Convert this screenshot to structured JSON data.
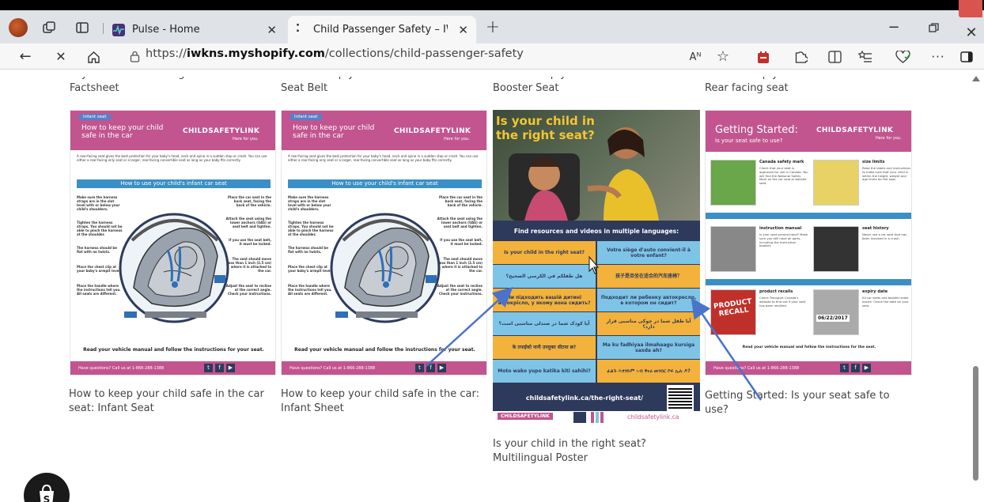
{
  "browser": {
    "tabs": [
      {
        "title": "Pulse - Home",
        "active": false
      },
      {
        "title": "Child Passenger Safety – IWK Chil",
        "active": true
      }
    ],
    "new_tab_label": "+",
    "url_prefix": "https://",
    "url_domain": "iwkns.myshopify.com",
    "url_path": "/collections/child-passenger-safety",
    "reader_label": "Aᴺ"
  },
  "top_captions": [
    "Is your child in the Right Seat? - Factsheet",
    "How to keep your child safe in the car: Seat Belt",
    "How to keep your child safe in the car: Booster Seat",
    "How to keep your child safe in the car: Rear facing seat"
  ],
  "products": [
    {
      "title": "How to keep your child safe in the car seat: Infant Seat",
      "tag": "Infant seat",
      "heading": "How to keep your child safe in the car",
      "brand": "CHILDSAFETYLINK",
      "brand_tagline": "Here for you.",
      "intro": "A rear-facing seat gives the best protection for your baby's head, neck and spine in a sudden stop or crash. You can use either a rear-facing only seat or a larger, rear-facing convertible seat as long as your baby fits correctly.",
      "section": "How to use your child's infant car seat",
      "left_notes": [
        "Make sure the harness straps are in the slot level with or below your child's shoulders.",
        "Tighten the harness straps. You should not be able to pinch the harness at the shoulder.",
        "The harness should be flat with no twists.",
        "Place the chest clip at your baby's armpit level.",
        "Place the handle where the instructions tell you. All seats are different."
      ],
      "right_notes": [
        "Place the car seat in the back seat, facing the back of the vehicle.",
        "Attach the seat using the lower anchors (UAS) or seat belt and tighten.",
        "If you use the seat belt, it must be locked.",
        "The seat should move less than 1 inch (2.5 cm) where it is attached to the car.",
        "Adjust the seat to recline at the correct angle. Check your instructions."
      ],
      "footer": "Read your vehicle manual and follow the instructions for your seat.",
      "contact": "Have questions? Call us at 1-866-288-1388"
    },
    {
      "title": "How to keep your child safe in the car: Infant Sheet",
      "tag": "Infant seat",
      "heading": "How to keep your child safe in the car",
      "brand": "CHILDSAFETYLINK",
      "brand_tagline": "Here for you.",
      "section": "How to use your child's infant car seat",
      "footer": "Read your vehicle manual and follow the instructions for your seat.",
      "contact": "Have questions? Call us at 1-866-288-1388"
    },
    {
      "title": "Is your child in the right seat? Multilingual Poster",
      "poster_title_1": "Is your child in",
      "poster_title_2": "the right seat?",
      "banner": "Find resources and videos in multiple languages:",
      "languages": [
        [
          "Is your child in the right seat?",
          "Votre siège d'auto convient-il à votre enfant?"
        ],
        [
          "هل طفلكم في الكرسي الصحيح؟",
          "孩子是否坐在适合的汽车座椅？"
        ],
        [
          "Чи підходить вашій дитині автокрісло, у якому вона сидить?",
          "Подходит ли ребенку автокресло, в котором он сидит?"
        ],
        [
          "آیا کودک شما در صندلی مناسبی است؟",
          "آیا طفل شما در چوکی مناسبی قرار دارد؟"
        ],
        [
          "के तपाईंको नानी उपयुक्त सीटमा छ?",
          "Ma ku fadhiyaa ilmahaagu kursiga saxda ah?"
        ],
        [
          "Moto wako yupo katika kiti sahihi?",
          "ፈልጉ ሕፃንኩም ኣብ ቅኑዕ መንበር ኮፍ ኢሉ ዶ?"
        ]
      ],
      "url": "childsafetylink.ca/the-right-seat/",
      "brand": "CHILDSAFETYLINK",
      "site": "childsafetylink.ca"
    },
    {
      "title": "Getting Started: Is your seat safe to use?",
      "heading": "Getting Started:",
      "subheading": "Is your seat safe to use?",
      "brand": "CHILDSAFETYLINK",
      "brand_tagline": "Here for you.",
      "items": [
        {
          "label": "Canada safety mark",
          "text": "Check that your seat is approved for use in Canada. You will find the National Safety Mark on the car seat or booster seat."
        },
        {
          "label": "size limits",
          "text": "Read the labels and instructions to make sure that your child is within the height, weight and age limits for the seat."
        },
        {
          "label": "instruction manual",
          "text": "Is your seat second-hand? Make sure you still have all parts, including the instruction booklet."
        },
        {
          "label": "seat history",
          "text": "Never use a car seat that has been involved in a crash."
        },
        {
          "label": "product recalls",
          "text": "Check Transport Canada's website to find out if your seat has been recalled."
        },
        {
          "label": "expiry date",
          "text": "All car seats and booster seats expire. Check the date on your seat."
        }
      ],
      "recall_text": "PRODUCT RECALL",
      "expiry_text": "06/22/2017",
      "footer": "Read your vehicle manual and follow the instructions for the seat.",
      "contact": "Have questions? Call us at 1-866-288-1388"
    }
  ],
  "colors": {
    "brand_pink": "#c2558f",
    "brand_dark": "#5a3a6b",
    "blue": "#3a8fc7",
    "navy": "#2e3a5c",
    "orange": "#f3b23b",
    "lightblue": "#7ec4e6",
    "arrow": "#4a73c9"
  }
}
